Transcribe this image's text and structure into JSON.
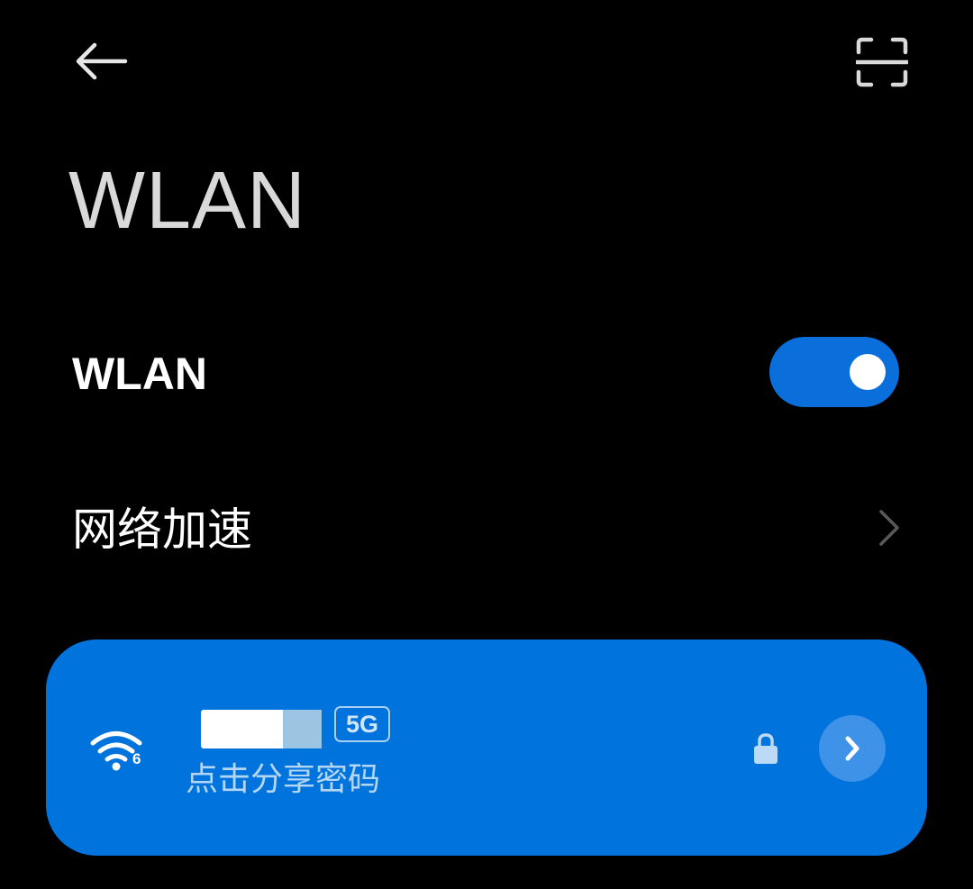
{
  "header": {
    "back_icon": "arrow-left-icon",
    "scan_icon": "scan-frame-icon",
    "title": "WLAN"
  },
  "settings": {
    "wlan_label": "WLAN",
    "wlan_enabled": true,
    "network_acceleration_label": "网络加速"
  },
  "connected_network": {
    "ssid": "",
    "band_badge": "5G",
    "wifi_generation": "6",
    "share_password_label": "点击分享密码",
    "secured": true,
    "signal_icon": "wifi-full-icon",
    "lock_icon": "lock-icon",
    "detail_icon": "chevron-right-icon"
  },
  "colors": {
    "background": "#000000",
    "accent": "#0073dc",
    "toggle_on": "#0a6fdb",
    "detail_button": "#3e92e8"
  }
}
